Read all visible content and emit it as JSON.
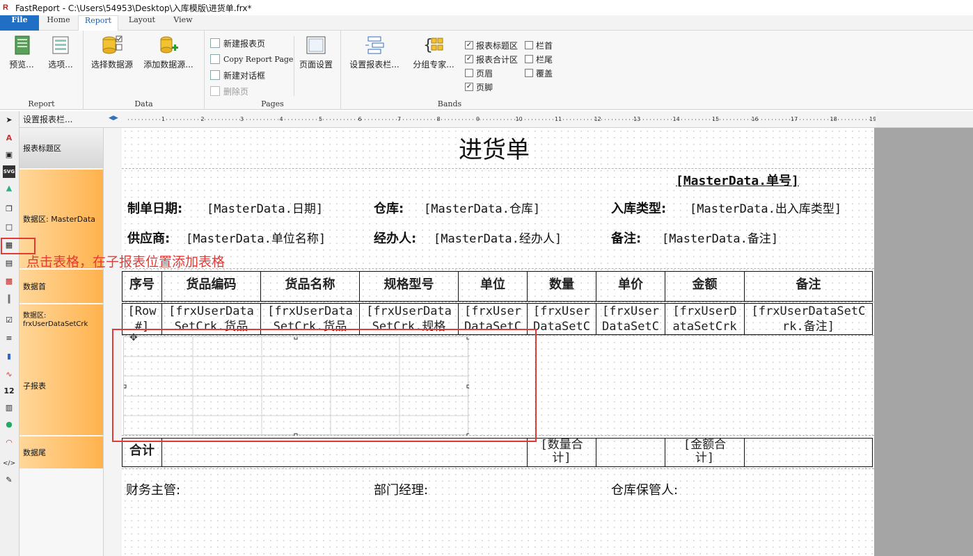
{
  "window": {
    "title": "FastReport - C:\\Users\\54953\\Desktop\\入库模版\\进货单.frx*"
  },
  "menu_tabs": [
    "File",
    "Home",
    "Report",
    "Layout",
    "View"
  ],
  "ribbon": {
    "report_group": {
      "label": "Report",
      "preview": "预览...",
      "options": "选项..."
    },
    "data_group": {
      "label": "Data",
      "select_source": "选择数据源",
      "add_source": "添加数据源..."
    },
    "pages_group": {
      "label": "Pages",
      "new_page": "新建报表页",
      "copy_page": "Copy Report Page",
      "new_dialog": "新建对话框",
      "delete_page": "删除页",
      "page_setup": "页面设置"
    },
    "bands_group": {
      "label": "Bands",
      "configure_bands": "设置报表栏...",
      "group_expert": "分组专家...",
      "checks": [
        {
          "label": "报表标题区",
          "checked": true
        },
        {
          "label": "报表合计区",
          "checked": true
        },
        {
          "label": "页眉",
          "checked": false
        },
        {
          "label": "页脚",
          "checked": true
        },
        {
          "label": "栏首",
          "checked": false
        },
        {
          "label": "栏尾",
          "checked": false
        },
        {
          "label": "覆盖",
          "checked": false
        }
      ]
    }
  },
  "band_panel": {
    "header": "设置报表栏...",
    "bands": [
      "报表标题区",
      "数据区: MasterData",
      "数据首",
      "数据区: frxUserDataSetCrk",
      "子报表",
      "数据尾"
    ]
  },
  "ruler": {
    "ticks": [
      "1",
      "2",
      "3",
      "4",
      "5",
      "6",
      "7",
      "8",
      "9",
      "10",
      "11",
      "12",
      "13",
      "14",
      "15",
      "16",
      "17",
      "18",
      "19"
    ]
  },
  "report": {
    "title": "进货单",
    "order_no": "[MasterData.单号]",
    "fields": {
      "date_label": "制单日期:",
      "date_value": "[MasterData.日期]",
      "warehouse_label": "仓库:",
      "warehouse_value": "[MasterData.仓库]",
      "type_label": "入库类型:",
      "type_value": "[MasterData.出入库类型]",
      "supplier_label": "供应商:",
      "supplier_value": "[MasterData.单位名称]",
      "handler_label": "经办人:",
      "handler_value": "[MasterData.经办人]",
      "remark_label": "备注:",
      "remark_value": "[MasterData.备注]"
    },
    "table_headers": [
      "序号",
      "货品编码",
      "货品名称",
      "规格型号",
      "单位",
      "数量",
      "单价",
      "金额",
      "备注"
    ],
    "table_row": [
      [
        "[Row",
        "#]"
      ],
      [
        "[frxUserData",
        "SetCrk.货品"
      ],
      [
        "[frxUserData",
        "SetCrk.货品"
      ],
      [
        "[frxUserData",
        "SetCrk.规格"
      ],
      [
        "[frxUser",
        "DataSetC"
      ],
      [
        "[frxUser",
        "DataSetC"
      ],
      [
        "[frxUser",
        "DataSetC"
      ],
      [
        "[frxUserD",
        "ataSetCrk"
      ],
      [
        "[frxUserDataSetC",
        "rk.备注]"
      ]
    ],
    "footer": {
      "total_label": "合计",
      "qty_total": [
        "[数量合",
        "计]"
      ],
      "amount_total": [
        "[金额合",
        "计]"
      ]
    },
    "signatures": [
      "财务主管:",
      "部门经理:",
      "仓库保管人:"
    ]
  },
  "annotation": "点击表格，在子报表位置添加表格",
  "colors": {
    "accent": "#1f6fc5",
    "annotation": "#e53935",
    "band_orange": "#ffb24d"
  }
}
